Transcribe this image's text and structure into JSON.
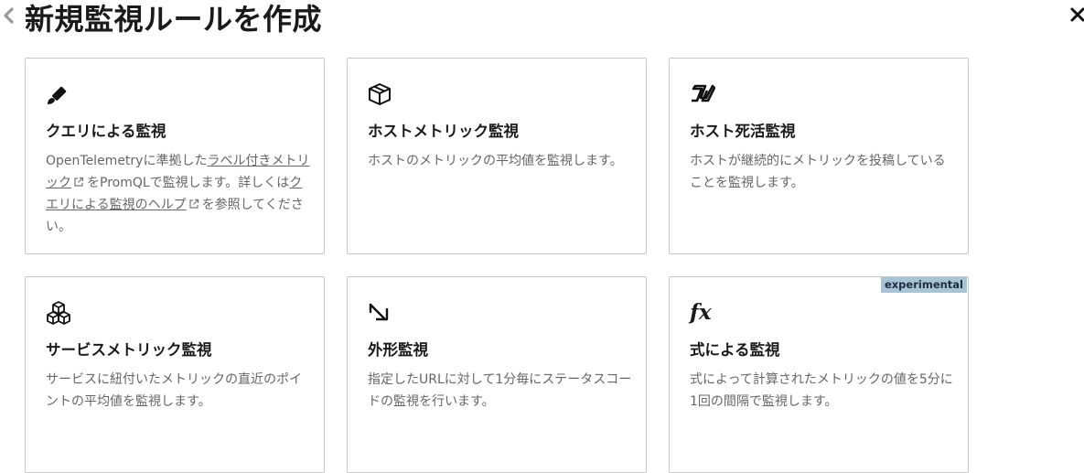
{
  "header": {
    "title": "新規監視ルールを作成",
    "back_icon": "chevron-left-icon",
    "close_icon": "close-icon"
  },
  "cards": [
    {
      "icon": "brush-icon",
      "title": "クエリによる監視",
      "desc": {
        "t1": "OpenTelemetryに準拠した",
        "link1": "ラベル付きメトリック",
        "t2": "をPromQLで監視します。詳しくは",
        "link2": "クエリによる監視のヘルプ",
        "t3": "を参照してください。"
      }
    },
    {
      "icon": "cube-icon",
      "title": "ホストメトリック監視",
      "desc": "ホストのメトリックの平均値を監視します。"
    },
    {
      "icon": "heartbeat-icon",
      "title": "ホスト死活監視",
      "desc": "ホストが継続的にメトリックを投稿していることを監視します。"
    },
    {
      "icon": "cubes-icon",
      "title": "サービスメトリック監視",
      "desc": "サービスに紐付いたメトリックの直近のポイントの平均値を監視します。"
    },
    {
      "icon": "external-check-icon",
      "title": "外形監視",
      "desc": "指定したURLに対して1分毎にステータスコードの監視を行います。"
    },
    {
      "icon": "fx-icon",
      "icon_text": "fx",
      "title": "式による監視",
      "desc": "式によって計算されたメトリックの値を5分に1回の間隔で監視します。",
      "badge": "experimental"
    }
  ]
}
